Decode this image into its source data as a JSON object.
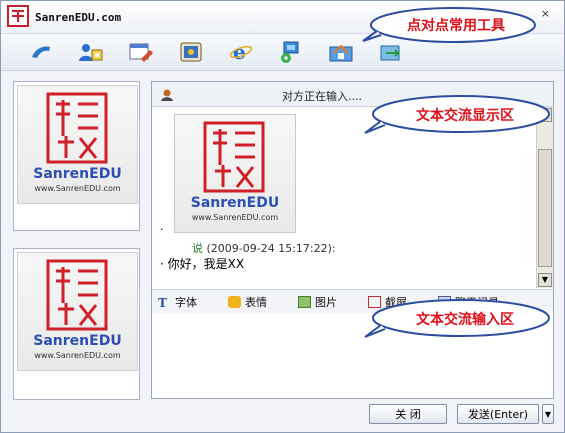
{
  "window": {
    "title": "SanrenEDU.com",
    "close_glyph": "×"
  },
  "toolbar": {
    "tools": [
      {
        "icon": "phone-icon"
      },
      {
        "icon": "add-contact-icon"
      },
      {
        "icon": "edit-note-icon"
      },
      {
        "icon": "media-player-icon"
      },
      {
        "icon": "ie-browser-icon"
      },
      {
        "icon": "network-icon"
      },
      {
        "icon": "home-folder-icon"
      },
      {
        "icon": "file-transfer-icon"
      }
    ]
  },
  "callouts": {
    "tools": "点对点常用工具",
    "display": "文本交流显示区",
    "input": "文本交流输入区"
  },
  "avatar": {
    "brand": "SanrenEDU",
    "url": "www.SanrenEDU.com",
    "seal_color": "#d0202a",
    "brand_color": "#2b4fb3"
  },
  "chat": {
    "status": "对方正在输入....",
    "messages": [
      {
        "bullet": "·",
        "sender_suffix": "说",
        "timestamp": "(2009-09-24 15:17:22):",
        "text": "你好，我是XX"
      }
    ]
  },
  "format_bar": {
    "font": "字体",
    "emoji": "表情",
    "picture": "图片",
    "screenshot": "截屏",
    "history": "聊天记录"
  },
  "buttons": {
    "close": "关  闭",
    "send": "发送(Enter)",
    "send_options": "▼"
  }
}
